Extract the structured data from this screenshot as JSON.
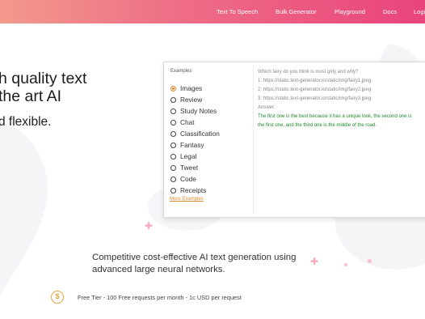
{
  "nav": {
    "tts": "Text To Speech",
    "bulk": "Bulk Generator",
    "playground": "Playground",
    "docs": "Docs",
    "login": "Login"
  },
  "hero": {
    "line1": "h quality text",
    "line2": "the art AI",
    "line3": "d flexible."
  },
  "examples": {
    "title": "Examples",
    "options": [
      "Images",
      "Review",
      "Study Notes",
      "Chat",
      "Classification",
      "Fantasy",
      "Legal",
      "Tweet",
      "Code",
      "Receipts"
    ],
    "selected": "Images",
    "more_link": "More Examples"
  },
  "prompt": {
    "question": "Which fairy do you think is most girly and why?",
    "line1": "1: https://static.text-generator.io/static/img/fairy1.jpeg",
    "line2": "2: https://static.text-generator.io/static/img/fairy2.jpeg",
    "line3": "3: https://static.text-generator.io/static/img/fairy3.jpeg",
    "answer_label": "Answer:",
    "answer1": "The first one is the best because it has a unique look, the second one is",
    "answer2": "the first one, and the third one is the middle of the road."
  },
  "tagline": {
    "line1": "Competitive cost-effective AI text generation using",
    "line2": "advanced large neural networks."
  },
  "pricing": {
    "icon": "dollar-icon",
    "symbol": "$",
    "tier": "Free Tier - 100 Free requests per month - 1c USD per request"
  },
  "colors": {
    "header_start": "#f39a8c",
    "header_end": "#e9447c",
    "accent": "#e08a2e",
    "answer": "#1f8a2a"
  }
}
